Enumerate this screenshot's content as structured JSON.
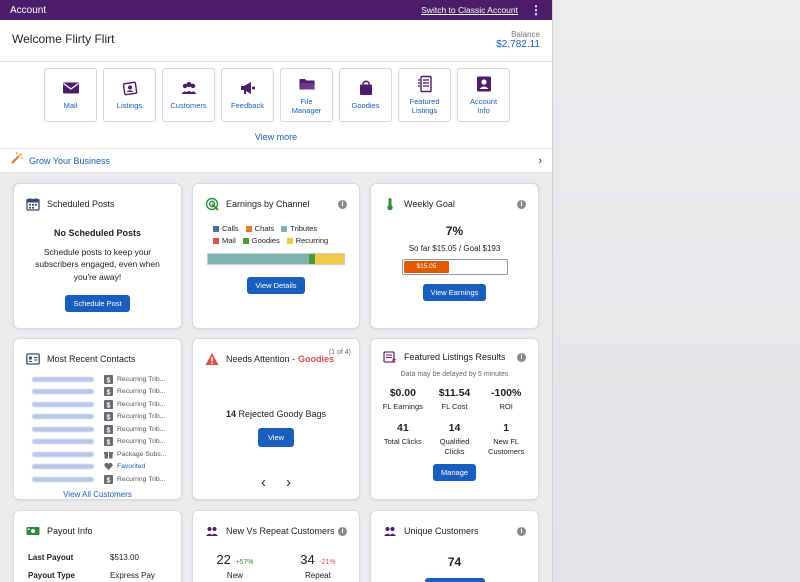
{
  "topbar": {
    "title": "Account",
    "switch_link": "Switch to Classic Account"
  },
  "welcome": {
    "greeting": "Welcome Flirty Flirt",
    "balance_label": "Balance",
    "balance_value": "$2,782.11"
  },
  "quick_links": [
    {
      "label": "Mail",
      "icon": "mail-icon"
    },
    {
      "label": "Listings",
      "icon": "listings-icon"
    },
    {
      "label": "Customers",
      "icon": "customers-icon"
    },
    {
      "label": "Feedback",
      "icon": "megaphone-icon"
    },
    {
      "label": "File\nManager",
      "icon": "folder-icon"
    },
    {
      "label": "Goodies",
      "icon": "shopping-bag-icon"
    },
    {
      "label": "Featured\nListings",
      "icon": "featured-list-icon"
    },
    {
      "label": "Account\nInfo",
      "icon": "account-card-icon"
    }
  ],
  "view_more": "View more",
  "grow": {
    "label": "Grow Your Business"
  },
  "scheduled_posts": {
    "title": "Scheduled Posts",
    "empty_title": "No Scheduled Posts",
    "empty_text": "Schedule posts to keep your subscribers engaged, even when you're away!",
    "button": "Schedule Post"
  },
  "earnings": {
    "title": "Earnings by Channel",
    "legend": [
      {
        "name": "Calls",
        "color": "#4a6fa5"
      },
      {
        "name": "Chats",
        "color": "#e07b2a"
      },
      {
        "name": "Tributes",
        "color": "#7fb3b0"
      },
      {
        "name": "Mail",
        "color": "#d9534f"
      },
      {
        "name": "Goodies",
        "color": "#4e9a3a"
      },
      {
        "name": "Recurring",
        "color": "#f0c94a"
      }
    ],
    "bar_shares": [
      {
        "name": "Tributes",
        "share": 0.74,
        "color": "#7fb3b0"
      },
      {
        "name": "Goodies",
        "share": 0.05,
        "color": "#4e9a3a"
      },
      {
        "name": "Recurring",
        "share": 0.21,
        "color": "#f0c94a"
      }
    ],
    "button": "View Details"
  },
  "weekly_goal": {
    "title": "Weekly Goal",
    "percent": "7%",
    "so_far": "So far $15.05 / Goal $193",
    "progress_label": "$15.05",
    "progress_fraction": 0.45,
    "button": "View Earnings"
  },
  "contacts": {
    "title": "Most Recent Contacts",
    "rows": [
      {
        "type": "Recurring Trib...",
        "icon": "dollar-icon"
      },
      {
        "type": "Recurring Trib...",
        "icon": "dollar-icon"
      },
      {
        "type": "Recurring Trib...",
        "icon": "dollar-icon"
      },
      {
        "type": "Recurring Trib...",
        "icon": "dollar-icon"
      },
      {
        "type": "Recurring Trib...",
        "icon": "dollar-icon"
      },
      {
        "type": "Recurring Trib...",
        "icon": "dollar-icon"
      },
      {
        "type": "Package Subs...",
        "icon": "gift-icon"
      },
      {
        "type": "Favorited",
        "icon": "heart-icon"
      },
      {
        "type": "Recurring Trib...",
        "icon": "dollar-icon"
      }
    ],
    "view_all": "View All Customers"
  },
  "attention": {
    "title": "Needs Attention -",
    "highlight": "Goodies",
    "counter": "(1 of 4)",
    "count": "14",
    "text": "Rejected Goody Bags",
    "button": "View",
    "prev": "‹",
    "next": "›"
  },
  "featured": {
    "title": "Featured Listings Results",
    "note": "Data may be delayed by 5 minutes",
    "stats": [
      {
        "value": "$0.00",
        "label": "FL Earnings"
      },
      {
        "value": "$11.54",
        "label": "FL Cost"
      },
      {
        "value": "-100%",
        "label": "ROI"
      },
      {
        "value": "41",
        "label": "Total Clicks"
      },
      {
        "value": "14",
        "label": "Qualified\nClicks"
      },
      {
        "value": "1",
        "label": "New FL\nCustomers"
      }
    ],
    "button": "Manage"
  },
  "payout": {
    "title": "Payout Info",
    "rows": [
      {
        "label": "Last Payout",
        "value": "$513.00"
      },
      {
        "label": "Payout Type",
        "value": "Express Pay"
      }
    ]
  },
  "new_repeat": {
    "title": "New Vs Repeat Customers",
    "new_value": "22",
    "new_change": "+57%",
    "new_label": "New",
    "repeat_value": "34",
    "repeat_change": "-21%",
    "repeat_label": "Repeat"
  },
  "unique": {
    "title": "Unique Customers",
    "value": "74"
  },
  "colors": {
    "brand": "#4b1d6a",
    "accent": "#1a5fbf",
    "positive": "#2e8b3a",
    "negative": "#d9534f",
    "goal_bar": "#e05a00"
  }
}
